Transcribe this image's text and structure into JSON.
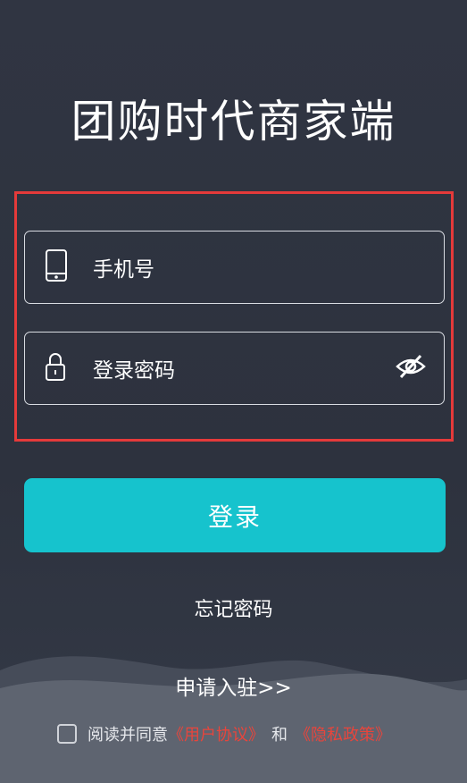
{
  "header": {
    "title": "团购时代商家端"
  },
  "form": {
    "phone_placeholder": "手机号",
    "password_placeholder": "登录密码",
    "phone_icon": "phone-icon",
    "lock_icon": "lock-icon",
    "visibility_icon": "eye-slash-icon"
  },
  "actions": {
    "login_label": "登录",
    "forgot_label": "忘记密码",
    "apply_label": "申请入驻>>"
  },
  "agreement": {
    "prefix": "阅读并同意",
    "user_agreement": "《用户协议》",
    "connector": "和",
    "privacy_policy": "《隐私政策》",
    "checked": false
  },
  "colors": {
    "background": "#2f3441",
    "accent": "#16c3cd",
    "highlight_border": "#e53a3a",
    "link": "#e8453c"
  }
}
